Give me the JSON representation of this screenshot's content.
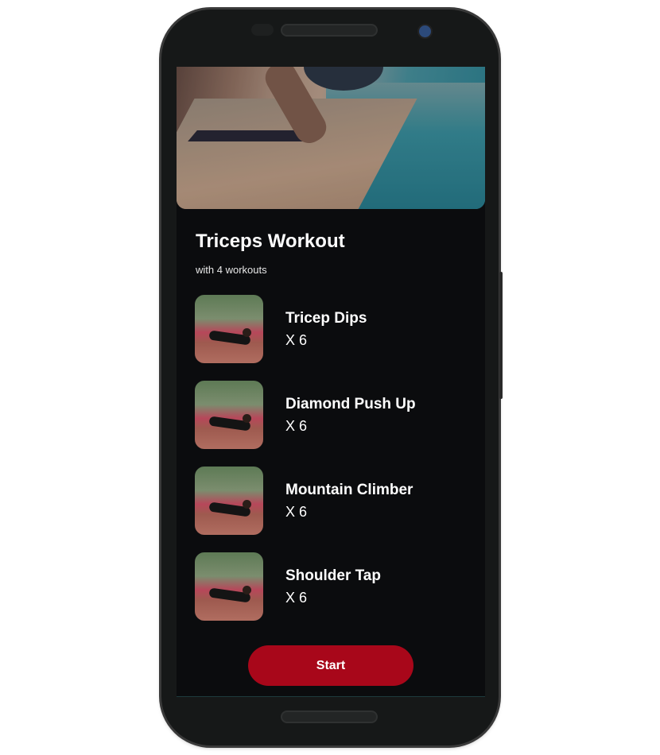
{
  "workout": {
    "title": "Triceps Workout",
    "subtitle": "with 4 workouts",
    "exercises": [
      {
        "name": "Tricep Dips",
        "reps": "X 6"
      },
      {
        "name": "Diamond Push Up",
        "reps": "X 6"
      },
      {
        "name": "Mountain Climber",
        "reps": "X 6"
      },
      {
        "name": "Shoulder Tap",
        "reps": "X 6"
      }
    ]
  },
  "actions": {
    "start_label": "Start"
  },
  "colors": {
    "accent": "#a8071a",
    "background": "#0b0c0e"
  }
}
